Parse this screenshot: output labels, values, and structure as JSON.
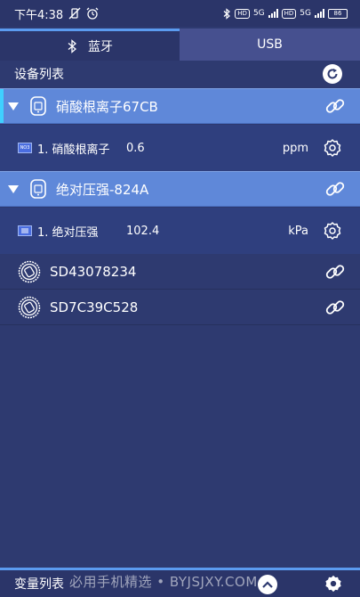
{
  "status_bar": {
    "time": "下午4:38",
    "net_badge_1": "HD",
    "net_label_1": "5G",
    "net_badge_2": "HD",
    "net_label_2": "5G",
    "battery": "86"
  },
  "tabs": [
    {
      "label": "蓝牙",
      "icon": "bluetooth-icon",
      "selected": true
    },
    {
      "label": "USB",
      "icon": "",
      "selected": false
    }
  ],
  "device_list": {
    "title": "设备列表"
  },
  "devices": [
    {
      "name": "硝酸根离子67CB",
      "expanded": true,
      "sensor": {
        "label": "1. 硝酸根离子",
        "value": "0.6",
        "unit": "ppm",
        "chip": "NO3"
      }
    },
    {
      "name": "绝对压强-824A",
      "expanded": true,
      "sensor": {
        "label": "1. 绝对压强",
        "value": "102.4",
        "unit": "kPa",
        "chip": ""
      }
    },
    {
      "name": "SD43078234",
      "expanded": false
    },
    {
      "name": "SD7C39C528",
      "expanded": false
    }
  ],
  "bottom": {
    "title": "变量列表",
    "watermark": "必用手机精选 • BYJSJXY.COM"
  },
  "colors": {
    "background": "#2e3a70",
    "selected_row": "#5f88d9",
    "sensor_row": "#2f3f7e",
    "accent": "#5b9bf0"
  }
}
